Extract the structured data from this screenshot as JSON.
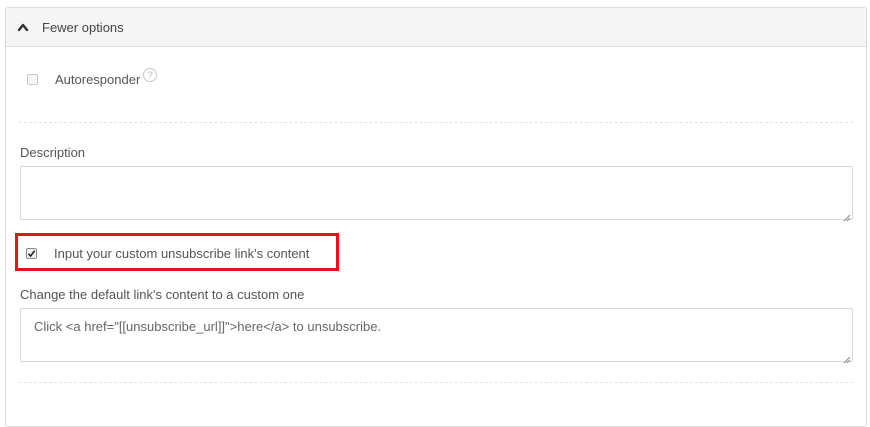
{
  "header": {
    "toggle_label": "Fewer options",
    "icon": "chevron-up-icon"
  },
  "autoresponder": {
    "label": "Autoresponder",
    "checked": false,
    "help_icon": "?"
  },
  "description": {
    "label": "Description",
    "value": ""
  },
  "custom_unsubscribe": {
    "label": "Input your custom unsubscribe link's content",
    "checked": true,
    "highlight_color": "#e3141a"
  },
  "unsubscribe_content": {
    "label": "Change the default link's content to a custom one",
    "value": "Click <a href=\"[[unsubscribe_url]]\">here</a> to unsubscribe."
  }
}
